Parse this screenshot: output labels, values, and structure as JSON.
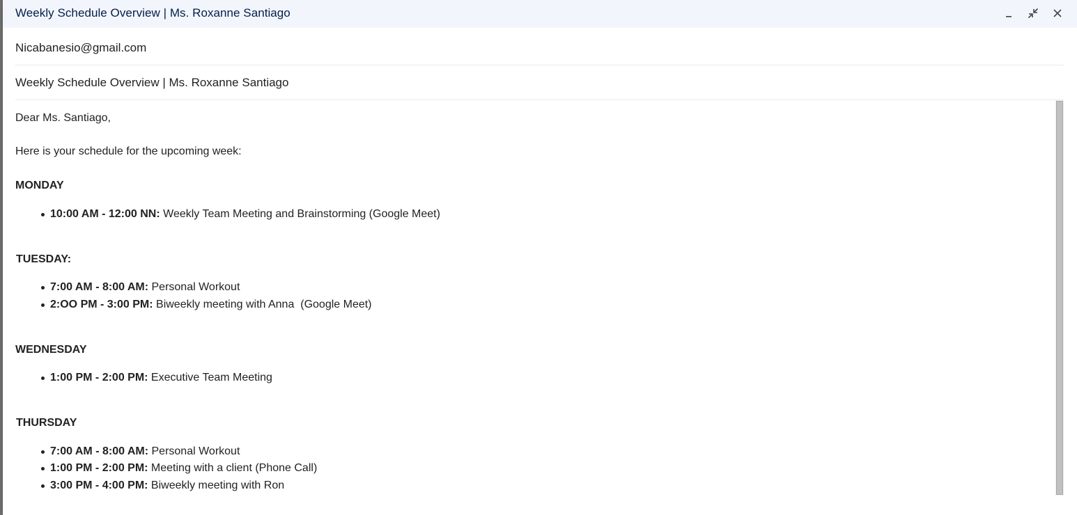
{
  "window": {
    "title": "Weekly Schedule Overview | Ms. Roxanne Santiago",
    "controls": [
      "minimize-icon",
      "exit-fullscreen-icon",
      "close-icon"
    ]
  },
  "recipient": "Nicabanesio@gmail.com",
  "subject": "Weekly Schedule Overview | Ms. Roxanne Santiago",
  "body": {
    "greeting": "Dear Ms. Santiago,",
    "intro": "Here is your schedule for the upcoming week:",
    "days": [
      {
        "name": "MONDAY",
        "items": [
          {
            "time": "10:00 AM - 12:00 NN:",
            "desc": " Weekly Team Meeting and Brainstorming (Google Meet)"
          }
        ]
      },
      {
        "name": "TUESDAY:",
        "items": [
          {
            "time": "7:00 AM - 8:00 AM:",
            "desc": " Personal Workout"
          },
          {
            "time": "2:OO PM - 3:00 PM:",
            "desc": " Biweekly meeting with Anna  (Google Meet)"
          }
        ]
      },
      {
        "name": "WEDNESDAY",
        "items": [
          {
            "time": "1:00 PM - 2:00 PM:",
            "desc": " Executive Team Meeting"
          }
        ]
      },
      {
        "name": "THURSDAY",
        "items": [
          {
            "time": "7:00 AM - 8:00 AM:",
            "desc": " Personal Workout"
          },
          {
            "time": "1:00 PM - 2:00 PM:",
            "desc": " Meeting with a client (Phone Call)"
          },
          {
            "time": "3:00 PM - 4:00 PM:",
            "desc": " Biweekly meeting with Ron"
          }
        ]
      }
    ]
  },
  "colors": {
    "titlebar_bg": "#f2f6fc",
    "title_text": "#041e49",
    "body_text": "#222222",
    "divider": "#e8eaed"
  }
}
